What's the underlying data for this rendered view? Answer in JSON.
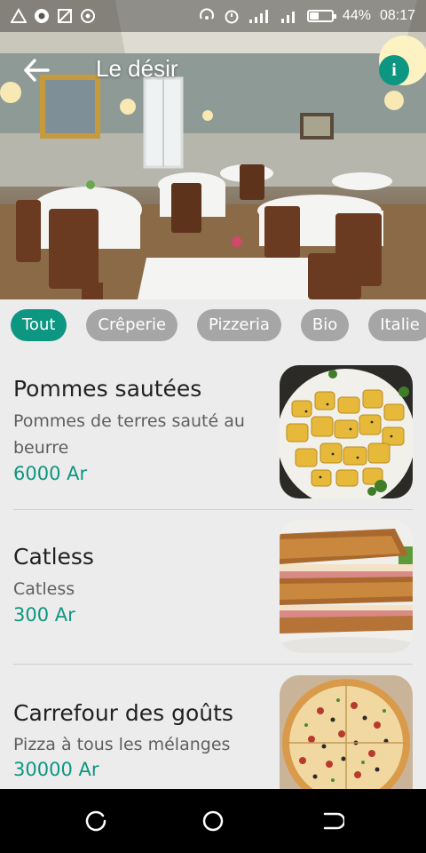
{
  "status_bar": {
    "battery_text": "44%",
    "battery_level": 0.44,
    "time": "08:17"
  },
  "app_bar": {
    "title": "Le désir",
    "back_icon": "arrow-left-icon",
    "info_icon": "info-icon",
    "info_glyph": "i"
  },
  "filters": [
    {
      "label": "Tout",
      "active": true
    },
    {
      "label": "Crêperie",
      "active": false
    },
    {
      "label": "Pizzeria",
      "active": false
    },
    {
      "label": "Bio",
      "active": false
    },
    {
      "label": "Italie",
      "active": false
    }
  ],
  "dishes": [
    {
      "name": "Pommes sautées",
      "description": "Pommes de terres sauté au beurre",
      "price": "6000 Ar"
    },
    {
      "name": "Catless",
      "description": "Catless",
      "price": "300 Ar"
    },
    {
      "name": "Carrefour des goûts",
      "description": "Pizza à tous les mélanges",
      "price": "30000 Ar"
    }
  ],
  "colors": {
    "accent": "#0d9682",
    "chip_inactive": "#a6a6a6",
    "background": "#ececec"
  },
  "nav_bar": {
    "back_icon": "recent-apps-icon",
    "home_icon": "home-circle-icon",
    "recents_icon": "back-icon"
  }
}
